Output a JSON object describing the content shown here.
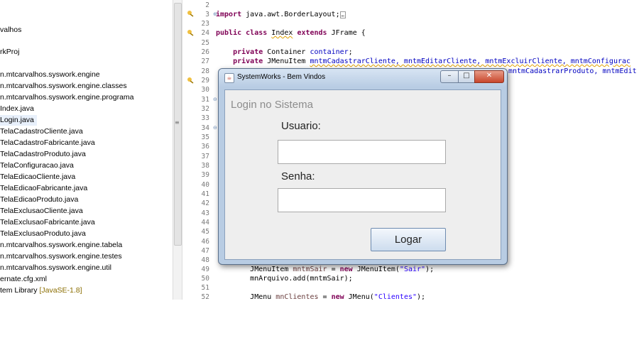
{
  "explorer": {
    "items": [
      {
        "label": "valhos",
        "suffix": ""
      },
      {
        "label": "rkProj",
        "suffix": ""
      },
      {
        "label": "n.mtcarvalhos.syswork.engine",
        "suffix": ""
      },
      {
        "label": "n.mtcarvalhos.syswork.engine.classes",
        "suffix": ""
      },
      {
        "label": "n.mtcarvalhos.syswork.engine.programa",
        "suffix": ""
      },
      {
        "label": "Index.java",
        "suffix": ""
      },
      {
        "label": "Login.java",
        "suffix": ""
      },
      {
        "label": "TelaCadastroCliente.java",
        "suffix": ""
      },
      {
        "label": "TelaCadastroFabricante.java",
        "suffix": ""
      },
      {
        "label": "TelaCadastroProduto.java",
        "suffix": ""
      },
      {
        "label": "TelaConfiguracao.java",
        "suffix": ""
      },
      {
        "label": "TelaEdicaoCliente.java",
        "suffix": ""
      },
      {
        "label": "TelaEdicaoFabricante.java",
        "suffix": ""
      },
      {
        "label": "TelaEdicaoProduto.java",
        "suffix": ""
      },
      {
        "label": "TelaExclusaoCliente.java",
        "suffix": ""
      },
      {
        "label": "TelaExclusaoFabricante.java",
        "suffix": ""
      },
      {
        "label": "TelaExclusaoProduto.java",
        "suffix": ""
      },
      {
        "label": "n.mtcarvalhos.syswork.engine.tabela",
        "suffix": ""
      },
      {
        "label": "n.mtcarvalhos.syswork.engine.testes",
        "suffix": ""
      },
      {
        "label": "n.mtcarvalhos.syswork.engine.util",
        "suffix": ""
      },
      {
        "label": "ernate.cfg.xml",
        "suffix": ""
      },
      {
        "label": "tem Library ",
        "suffix": "[JavaSE-1.8]"
      }
    ],
    "selected_item": "Login.java"
  },
  "editor": {
    "line_numbers": [
      "2",
      "3",
      "23",
      "24",
      "25",
      "26",
      "27",
      "28",
      "29",
      "30",
      "31",
      "32",
      "33",
      "34",
      "35",
      "36",
      "37",
      "38",
      "39",
      "40",
      "41",
      "42",
      "43",
      "44",
      "45",
      "46",
      "47",
      "48",
      "49",
      "50",
      "51",
      "52"
    ],
    "code": {
      "import_kw": "import",
      "import_rest": " java.awt.BorderLayout;",
      "public_kw": "public",
      "class_kw": "class",
      "class_name": "Index",
      "extends_kw": "extends",
      "class_rest": " JFrame {",
      "private_kw": "private",
      "container_type": " Container ",
      "container_field": "container",
      "semicolon": ";",
      "menuitem_type": " JMenuItem ",
      "menuitems_line1": "mntmCadastrarCliente, mntmEditarCliente, mntmExcluirCliente, mntmConfigurac",
      "menuitems_line2": "mntmCadastrarProduto, mntmEdit",
      "sair_type": "JMenuItem ",
      "sair_var": "mntmSair",
      "assign": " = ",
      "new_kw": "new",
      "sair_ctor": " JMenuItem(",
      "sair_str": "\"Sair\"",
      "close_paren": ");",
      "add_call": "mnArquivo.add(mntmSair);",
      "jmenu_type": "JMenu ",
      "clientes_var": "mnClientes",
      "jmenu_ctor": " JMenu(",
      "clientes_str": "\"Clientes\""
    }
  },
  "dialog": {
    "title": "SystemWorks - Bem Vindos",
    "heading": "Login no Sistema",
    "usuario_label": "Usuario:",
    "usuario_value": "",
    "senha_label": "Senha:",
    "senha_value": "",
    "login_button": "Logar",
    "window_controls": {
      "minimize": "–",
      "maximize": "□",
      "close": "✕"
    }
  },
  "colors": {
    "keyword": "#7f0055",
    "field": "#0000c0",
    "string": "#2a00ff",
    "titlebar": "#c6d7ea"
  }
}
